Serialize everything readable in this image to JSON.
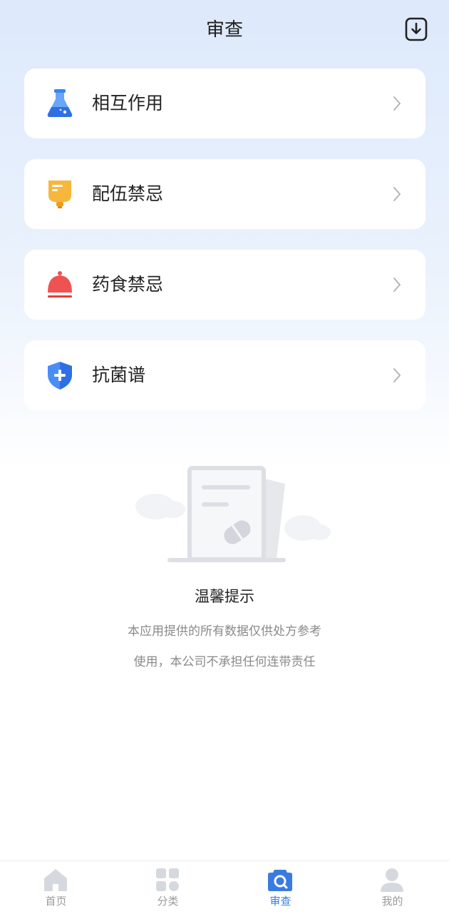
{
  "header": {
    "title": "审查"
  },
  "cards": [
    {
      "label": "相互作用",
      "icon": "flask-icon",
      "color": "#3b82f6"
    },
    {
      "label": "配伍禁忌",
      "icon": "iv-bag-icon",
      "color": "#f5a623"
    },
    {
      "label": "药食禁忌",
      "icon": "bell-food-cover-icon",
      "color": "#f05252"
    },
    {
      "label": "抗菌谱",
      "icon": "shield-plus-icon",
      "color": "#3b82f6"
    }
  ],
  "notice": {
    "title": "温馨提示",
    "line1": "本应用提供的所有数据仅供处方参考",
    "line2": "使用，本公司不承担任何连带责任"
  },
  "tabbar": {
    "active_color": "#3a7be0",
    "items": [
      {
        "label": "首页",
        "icon": "home-icon"
      },
      {
        "label": "分类",
        "icon": "grid-icon"
      },
      {
        "label": "审查",
        "icon": "review-icon",
        "active": true
      },
      {
        "label": "我的",
        "icon": "user-icon"
      }
    ]
  }
}
